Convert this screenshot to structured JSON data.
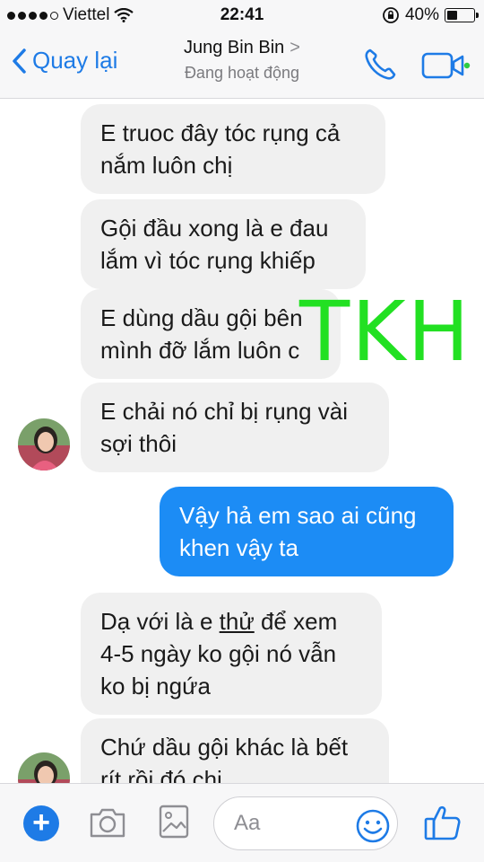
{
  "status_bar": {
    "carrier": "Viettel",
    "time": "22:41",
    "battery": "40%",
    "battery_level": 0.4
  },
  "header": {
    "back_label": "Quay lại",
    "contact_name": "Jung Bin Bin",
    "chevron": ">",
    "status": "Đang hoạt động"
  },
  "messages": [
    {
      "side": "in",
      "lines": [
        "E truoc đây tóc rụng cả",
        "nắm luôn chị"
      ]
    },
    {
      "side": "in",
      "lines": [
        "Gội đầu xong là e đau",
        "lắm vì tóc rụng khiếp"
      ]
    },
    {
      "side": "in",
      "lines": [
        "E dùng dầu gội bên",
        "mình đỡ lắm luôn c"
      ]
    },
    {
      "side": "in",
      "lines": [
        "E chải nó chỉ bị rụng vài",
        "sợi thôi"
      ]
    },
    {
      "side": "out",
      "lines": [
        "Vậy hả em sao ai cũng",
        "khen vậy ta"
      ]
    },
    {
      "side": "in",
      "lines": [
        "Dạ với là e thử để xem",
        "4-5 ngày ko gội nó vẫn",
        "ko bị ngứa"
      ]
    },
    {
      "side": "in",
      "lines": [
        "Chứ dầu gội khác là bết",
        "rít rồi đó chị"
      ]
    }
  ],
  "watermark": "TKH",
  "composer": {
    "placeholder": "Aa"
  },
  "colors": {
    "accent": "#1e7be6",
    "outgoing_bubble": "#1c8cf5",
    "incoming_bubble": "#f0f0f0",
    "watermark": "#22e022"
  },
  "icons": [
    "signal-dots-icon",
    "wifi-icon",
    "lock-rotation-icon",
    "battery-icon",
    "back-chevron-icon",
    "phone-icon",
    "video-icon",
    "plus-icon",
    "camera-icon",
    "image-icon",
    "emoji-icon",
    "thumbs-up-icon"
  ]
}
